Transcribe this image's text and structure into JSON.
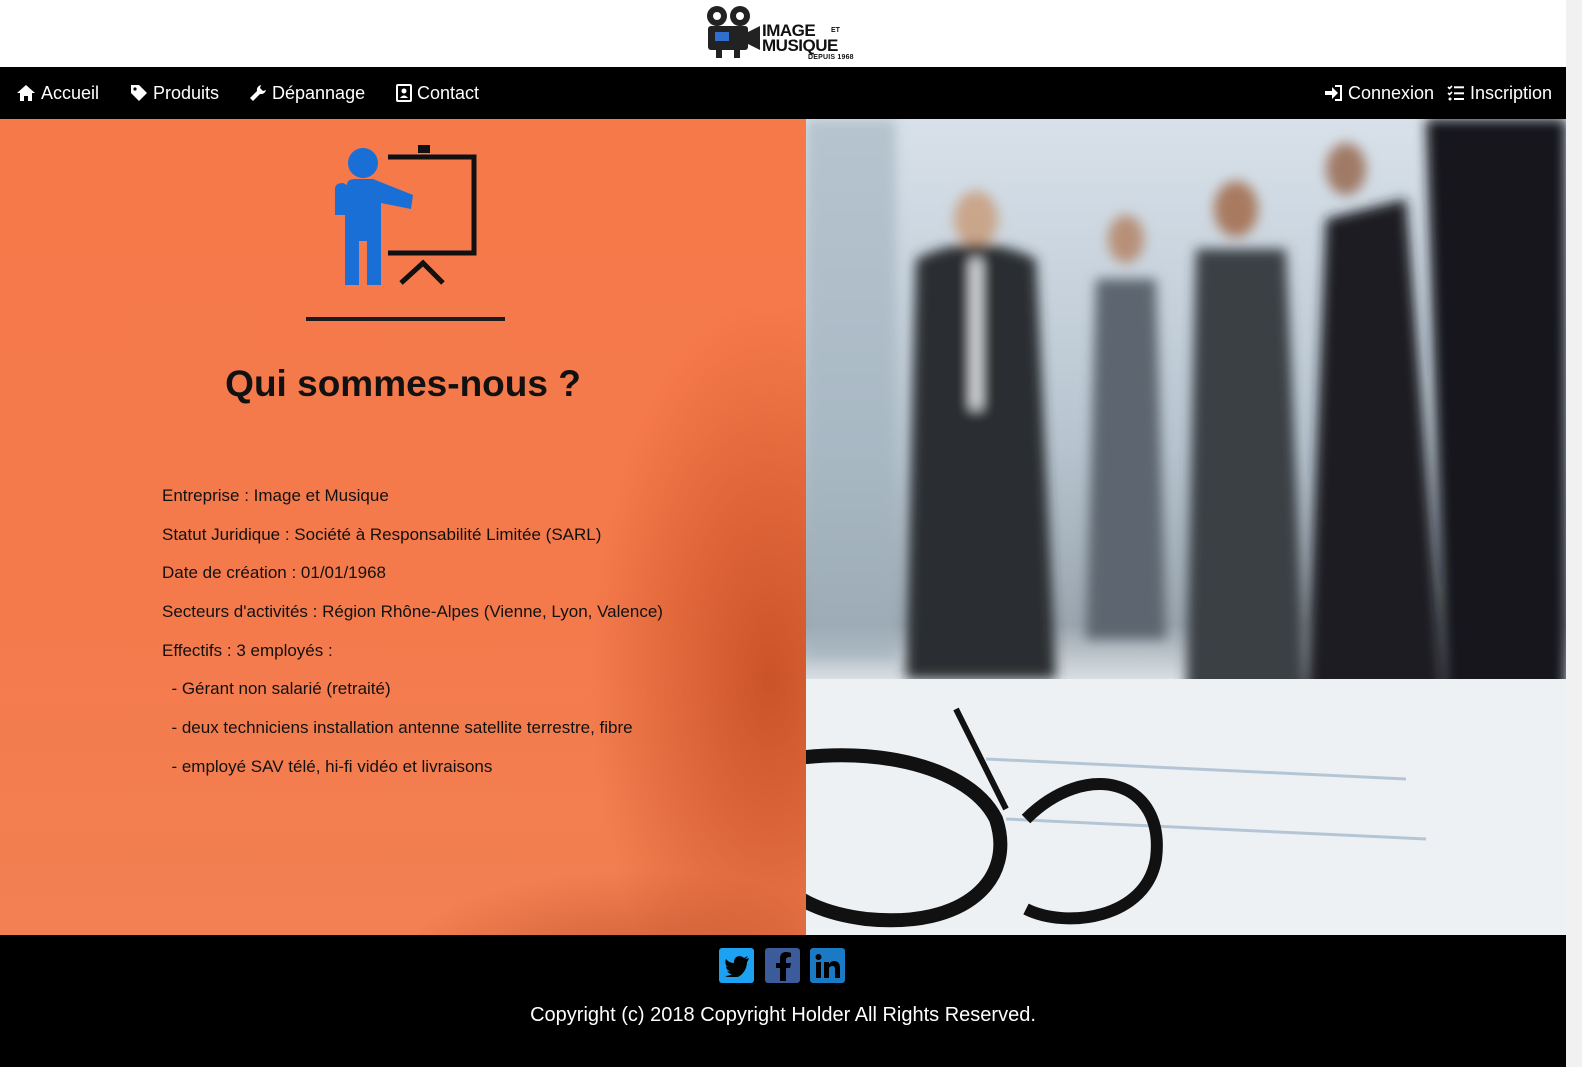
{
  "logo": {
    "line1": "IMAGE",
    "line2": "MUSIQUE",
    "small": "ET",
    "since": "DEPUIS 1968"
  },
  "nav": {
    "left": [
      {
        "label": "Accueil",
        "icon": "home-icon"
      },
      {
        "label": "Produits",
        "icon": "tag-icon"
      },
      {
        "label": "Dépannage",
        "icon": "wrench-icon"
      },
      {
        "label": "Contact",
        "icon": "contact-card-icon"
      }
    ],
    "right": [
      {
        "label": "Connexion",
        "icon": "sign-in-icon"
      },
      {
        "label": "Inscription",
        "icon": "list-check-icon"
      }
    ]
  },
  "about": {
    "title": "Qui sommes-nous ?",
    "icon": "presentation-icon",
    "lines": [
      "Entreprise : Image et Musique",
      "Statut Juridique : Société à Responsabilité Limitée (SARL)",
      "Date de création : 01/01/1968",
      "Secteurs d'activités : Région Rhône-Alpes (Vienne, Lyon, Valence)",
      "Effectifs : 3 employés :",
      "  - Gérant non salarié (retraité)",
      "  - deux techniciens installation antenne satellite terrestre, fibre",
      "  - employé SAV télé, hi-fi vidéo et livraisons"
    ]
  },
  "footer": {
    "social": [
      "twitter-icon",
      "facebook-icon",
      "linkedin-icon"
    ],
    "copyright": "Copyright (c) 2018 Copyright Holder All Rights Reserved."
  },
  "colors": {
    "accent": "#f47a4c",
    "social_blue": "#1da1f2",
    "icon_blue": "#1a6fd6",
    "navbar": "#000000"
  }
}
